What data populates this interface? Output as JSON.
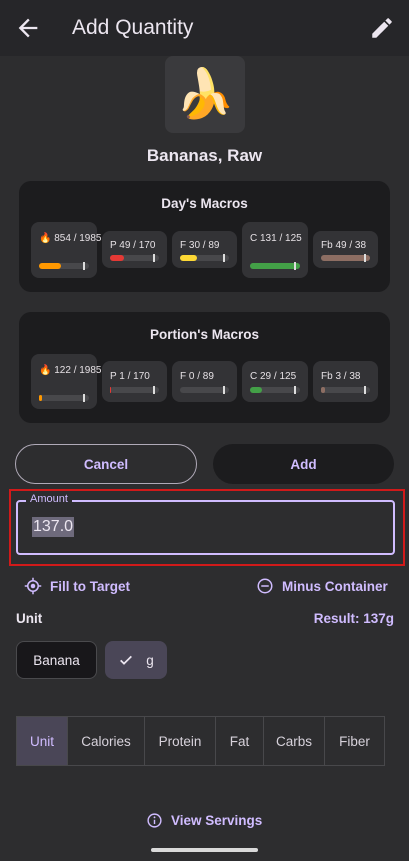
{
  "appbar": {
    "title": "Add Quantity",
    "back_icon": "arrow-back-icon",
    "edit_icon": "pencil-icon"
  },
  "food": {
    "name": "Bananas, Raw",
    "image_emoji": "🍌"
  },
  "days_macros": {
    "title": "Day's Macros",
    "tiles": [
      {
        "label": "🔥 854 / 1985",
        "fraction": 0.43,
        "color": "#ff9800"
      },
      {
        "label": "P 49 / 170",
        "fraction": 0.29,
        "color": "#e53935"
      },
      {
        "label": "F 30 / 89",
        "fraction": 0.34,
        "color": "#fdd835"
      },
      {
        "label": "C 131 / 125",
        "fraction": 1.0,
        "color": "#43a047"
      },
      {
        "label": "Fb 49 / 38",
        "fraction": 1.0,
        "color": "#8d6e63"
      }
    ]
  },
  "portion_macros": {
    "title": "Portion's Macros",
    "tiles": [
      {
        "label": "🔥 122 / 1985",
        "fraction": 0.06,
        "color": "#ff9800"
      },
      {
        "label": "P 1 / 170",
        "fraction": 0.01,
        "color": "#e53935"
      },
      {
        "label": "F 0 / 89",
        "fraction": 0.0,
        "color": "#fdd835"
      },
      {
        "label": "C 29 / 125",
        "fraction": 0.23,
        "color": "#43a047"
      },
      {
        "label": "Fb 3 / 38",
        "fraction": 0.08,
        "color": "#8d6e63"
      }
    ]
  },
  "actions": {
    "cancel": "Cancel",
    "add": "Add"
  },
  "amount": {
    "label": "Amount",
    "value": "137.0"
  },
  "links": {
    "fill_to_target": "Fill to Target",
    "minus_container": "Minus Container",
    "view_servings": "View Servings"
  },
  "unit": {
    "label": "Unit",
    "result": "Result: 137g",
    "options": [
      "Banana",
      "g"
    ],
    "selected": "g"
  },
  "segments": {
    "options": [
      "Unit",
      "Calories",
      "Protein",
      "Fat",
      "Carbs",
      "Fiber"
    ],
    "selected": "Unit"
  }
}
